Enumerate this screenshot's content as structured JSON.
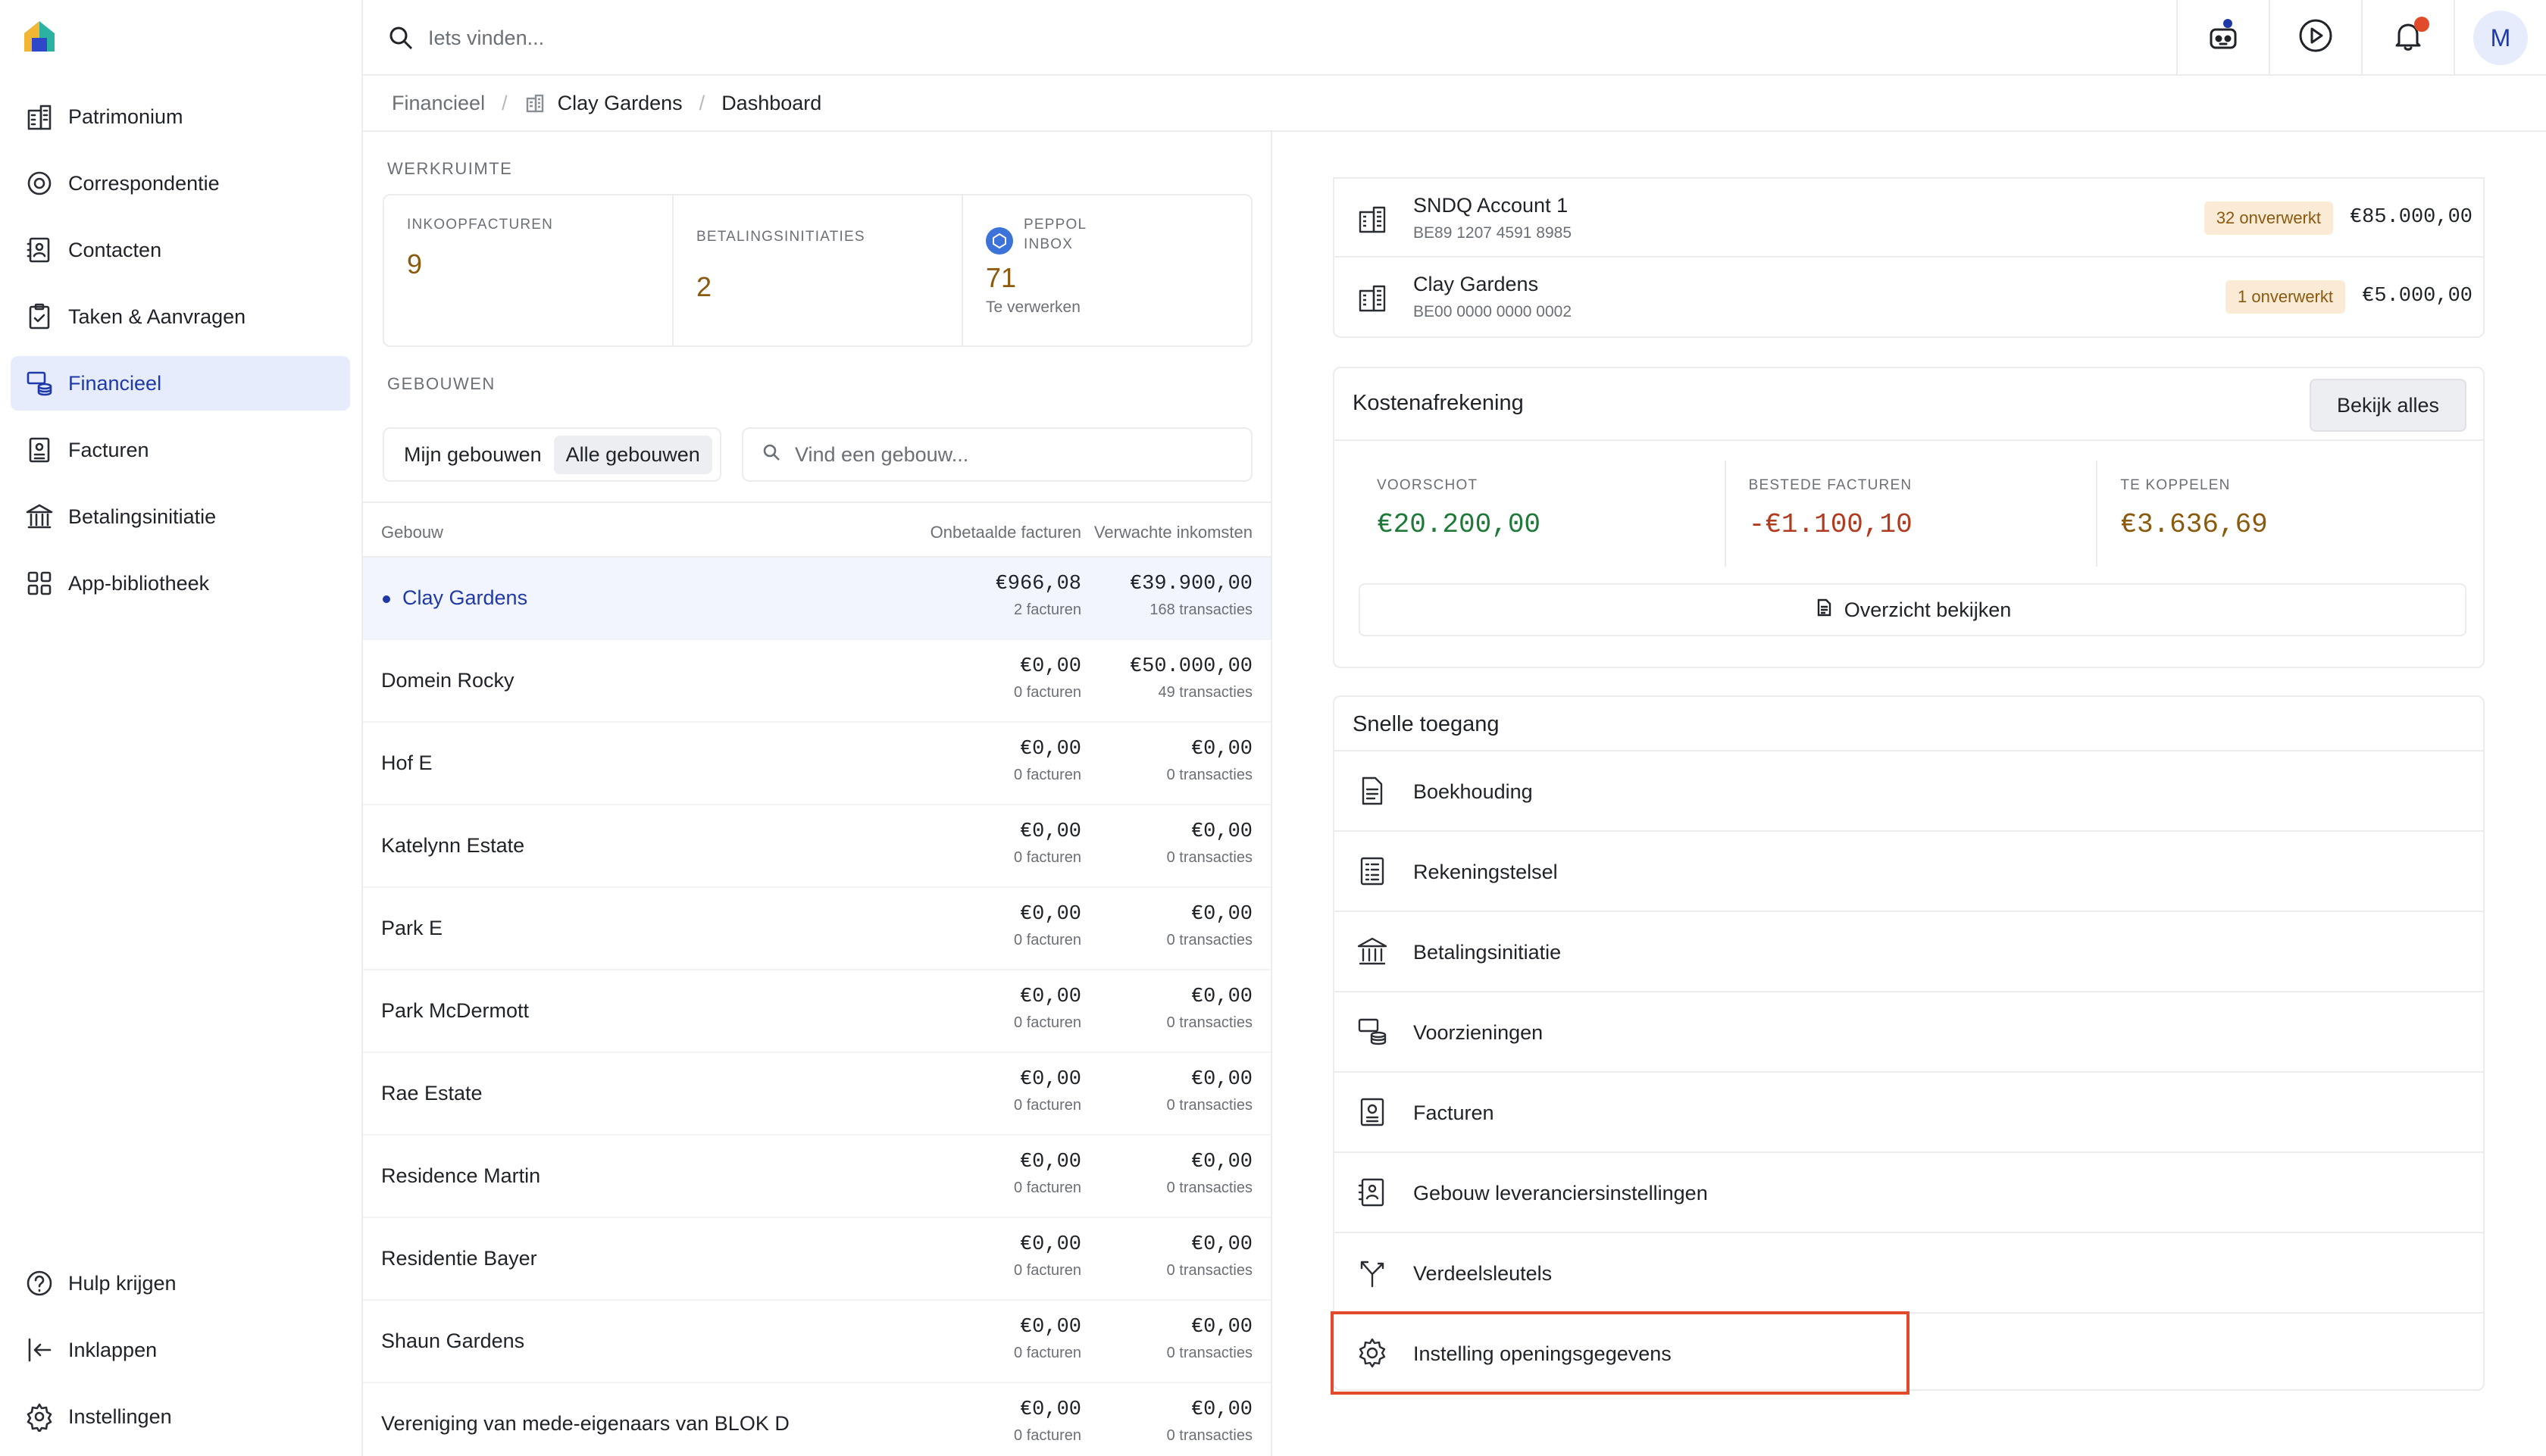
{
  "app": {
    "accent": "#1f3aa8",
    "highlight_color": "#e14b2b"
  },
  "search": {
    "placeholder": "Iets vinden..."
  },
  "topbar": {
    "avatar_initial": "M",
    "icons": [
      "assistant-robot-icon",
      "play-circle-icon",
      "bell-icon"
    ]
  },
  "sidebar": {
    "items": [
      {
        "label": "Patrimonium",
        "icon": "buildings-icon",
        "active": false
      },
      {
        "label": "Correspondentie",
        "icon": "inbox-ring-icon",
        "active": false
      },
      {
        "label": "Contacten",
        "icon": "contacts-book-icon",
        "active": false
      },
      {
        "label": "Taken & Aanvragen",
        "icon": "clipboard-check-icon",
        "active": false
      },
      {
        "label": "Financieel",
        "icon": "coins-stack-icon",
        "active": true
      },
      {
        "label": "Facturen",
        "icon": "receipt-icon",
        "active": false
      },
      {
        "label": "Betalingsinitiatie",
        "icon": "bank-icon",
        "active": false
      },
      {
        "label": "App-bibliotheek",
        "icon": "apps-grid-icon",
        "active": false
      }
    ],
    "bottom": [
      {
        "label": "Hulp krijgen",
        "icon": "help-circle-icon"
      },
      {
        "label": "Inklappen",
        "icon": "collapse-arrow-icon"
      },
      {
        "label": "Instellingen",
        "icon": "gear-icon"
      }
    ]
  },
  "breadcrumb": {
    "root": "Financieel",
    "building": "Clay Gardens",
    "page": "Dashboard"
  },
  "workspace": {
    "title": "WERKRUIMTE",
    "cards": [
      {
        "label": "INKOOPFACTUREN",
        "value": "9"
      },
      {
        "label": "BETALINGSINITIATIES",
        "value": "2"
      },
      {
        "label_line1": "PEPPOL",
        "label_line2": "INBOX",
        "value": "71",
        "sub": "Te verwerken"
      }
    ]
  },
  "buildings": {
    "title": "GEBOUWEN",
    "toggle": {
      "mine": "Mijn gebouwen",
      "all": "Alle gebouwen",
      "selected": "all"
    },
    "search_placeholder": "Vind een gebouw...",
    "columns": {
      "name": "Gebouw",
      "unpaid": "Onbetaalde facturen",
      "income": "Verwachte inkomsten"
    },
    "rows": [
      {
        "name": "Clay Gardens",
        "unpaid": "€966,08",
        "unpaid_sub": "2 facturen",
        "income": "€39.900,00",
        "income_sub": "168 transacties",
        "active": true
      },
      {
        "name": "Domein Rocky",
        "unpaid": "€0,00",
        "unpaid_sub": "0 facturen",
        "income": "€50.000,00",
        "income_sub": "49 transacties"
      },
      {
        "name": "Hof E",
        "unpaid": "€0,00",
        "unpaid_sub": "0 facturen",
        "income": "€0,00",
        "income_sub": "0 transacties"
      },
      {
        "name": "Katelynn Estate",
        "unpaid": "€0,00",
        "unpaid_sub": "0 facturen",
        "income": "€0,00",
        "income_sub": "0 transacties"
      },
      {
        "name": "Park E",
        "unpaid": "€0,00",
        "unpaid_sub": "0 facturen",
        "income": "€0,00",
        "income_sub": "0 transacties"
      },
      {
        "name": "Park McDermott",
        "unpaid": "€0,00",
        "unpaid_sub": "0 facturen",
        "income": "€0,00",
        "income_sub": "0 transacties"
      },
      {
        "name": "Rae Estate",
        "unpaid": "€0,00",
        "unpaid_sub": "0 facturen",
        "income": "€0,00",
        "income_sub": "0 transacties"
      },
      {
        "name": "Residence Martin",
        "unpaid": "€0,00",
        "unpaid_sub": "0 facturen",
        "income": "€0,00",
        "income_sub": "0 transacties"
      },
      {
        "name": "Residentie Bayer",
        "unpaid": "€0,00",
        "unpaid_sub": "0 facturen",
        "income": "€0,00",
        "income_sub": "0 transacties"
      },
      {
        "name": "Shaun Gardens",
        "unpaid": "€0,00",
        "unpaid_sub": "0 facturen",
        "income": "€0,00",
        "income_sub": "0 transacties"
      },
      {
        "name": "Vereniging van mede-eigenaars van BLOK D",
        "unpaid": "€0,00",
        "unpaid_sub": "0 facturen",
        "income": "€0,00",
        "income_sub": "0 transacties"
      }
    ]
  },
  "accounts": [
    {
      "name": "SNDQ Account 1",
      "iban": "BE89 1207 4591 8985",
      "badge": "32 onverwerkt",
      "amount": "€85.000,00"
    },
    {
      "name": "Clay Gardens",
      "iban": "BE00 0000 0000 0002",
      "badge": "1 onverwerkt",
      "amount": "€5.000,00"
    }
  ],
  "kosten": {
    "title": "Kostenafrekening",
    "button": "Bekijk alles",
    "stats": [
      {
        "label": "VOORSCHOT",
        "value": "€20.200,00",
        "color": "#1f7a3a"
      },
      {
        "label": "BESTEDE FACTUREN",
        "value": "-€1.100,10",
        "color": "#b23a1f"
      },
      {
        "label": "TE KOPPELEN",
        "value": "€3.636,69",
        "color": "#8a5a0e"
      }
    ],
    "overview_button": "Overzicht bekijken"
  },
  "quick_access": {
    "title": "Snelle toegang",
    "items": [
      {
        "label": "Boekhouding",
        "icon": "document-icon"
      },
      {
        "label": "Rekeningstelsel",
        "icon": "list-sheet-icon"
      },
      {
        "label": "Betalingsinitiatie",
        "icon": "bank-icon"
      },
      {
        "label": "Voorzieningen",
        "icon": "coins-stack-icon"
      },
      {
        "label": "Facturen",
        "icon": "receipt-icon"
      },
      {
        "label": "Gebouw leveranciersinstellingen",
        "icon": "contacts-book-icon"
      },
      {
        "label": "Verdeelsleutels",
        "icon": "split-arrow-icon"
      },
      {
        "label": "Instelling openingsgegevens",
        "icon": "gear-icon"
      }
    ]
  }
}
